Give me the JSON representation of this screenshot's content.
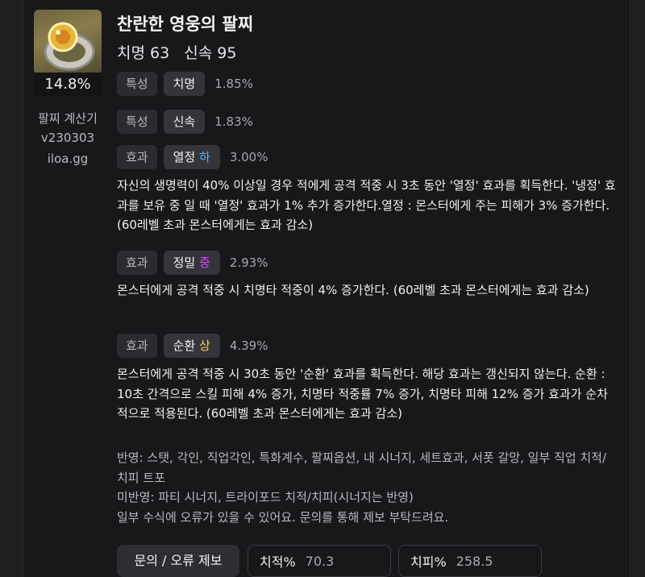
{
  "item": {
    "name": "찬란한 영웅의 팔찌",
    "stat1": "치명 63",
    "stat2": "신속 95",
    "percent": "14.8%"
  },
  "sidebar": {
    "line1": "팔찌 계산기",
    "line2": "v230303",
    "line3": "iloa.gg"
  },
  "rows": [
    {
      "type": "특성",
      "name": "치명",
      "grade": "",
      "value": "1.85%"
    },
    {
      "type": "특성",
      "name": "신속",
      "grade": "",
      "value": "1.83%"
    },
    {
      "type": "효과",
      "name": "열정",
      "grade": "하",
      "value": "3.00%"
    },
    {
      "type": "효과",
      "name": "정밀",
      "grade": "중",
      "value": "2.93%"
    },
    {
      "type": "효과",
      "name": "순환",
      "grade": "상",
      "value": "4.39%"
    }
  ],
  "descriptions": [
    "자신의 생명력이 40% 이상일 경우 적에게 공격 적중 시 3초 동안 '열정' 효과를 획득한다. '냉정' 효과를 보유 중 일 때 '열정' 효과가 1% 추가 증가한다.열정 : 몬스터에게 주는 피해가 3% 증가한다. (60레벨 초과 몬스터에게는 효과 감소)",
    "몬스터에게 공격 적중 시 치명타 적중이 4% 증가한다. (60레벨 초과 몬스터에게는 효과 감소)",
    "몬스터에게 공격 적중 시 30초 동안 '순환' 효과를 획득한다. 해당 효과는 갱신되지 않는다. 순환 : 10초 간격으로 스킬 피해 4% 증가, 치명타 적중률 7% 증가, 치명타 피해 12% 증가 효과가 순차적으로 적용된다. (60레벨 초과 몬스터에게는 효과 감소)"
  ],
  "notes": {
    "reflected": "반영: 스탯, 각인, 직업각인, 특화계수, 팔찌옵션, 내 시너지, 세트효과, 서폿 갈망, 일부 직업 치적/치피 트포",
    "not_reflected": "미반영: 파티 시너지, 트라이포드 치적/치피(시너지는 반영)",
    "disclaimer": "일부 수식에 오류가 있을 수 있어요. 문의를 통해 제보 부탁드려요."
  },
  "footer": {
    "report_button": "문의 / 오류 제보",
    "crit_rate_label": "치적%",
    "crit_rate_value": "70.3",
    "crit_dmg_label": "치피%",
    "crit_dmg_value": "258.5"
  }
}
